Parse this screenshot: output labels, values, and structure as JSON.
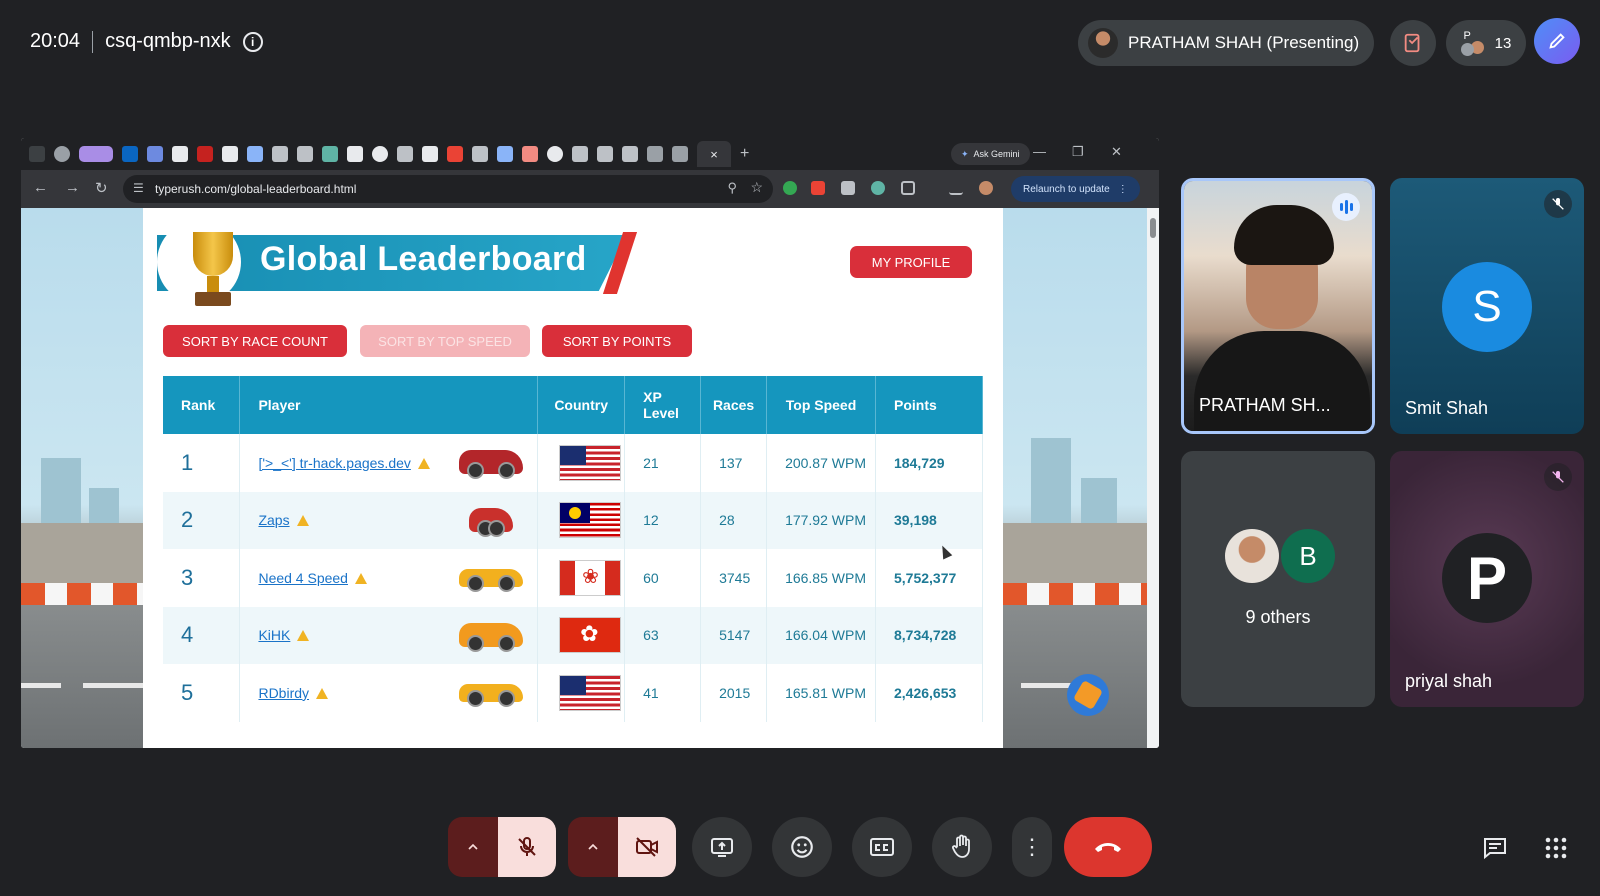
{
  "meeting": {
    "time": "20:04",
    "code": "csq-qmbp-nxk",
    "presenter_label": "PRATHAM SHAH (Presenting)",
    "participant_count": "13",
    "participant_initial": "P"
  },
  "browser": {
    "active_tab_close": "×",
    "new_tab": "+",
    "ask_gemini": "Ask Gemini",
    "url": "typerush.com/global-leaderboard.html",
    "relaunch": "Relaunch to update"
  },
  "page": {
    "title": "Global Leaderboard",
    "my_profile": "MY PROFILE",
    "sort_race_count": "SORT BY RACE COUNT",
    "sort_top_speed": "SORT BY TOP SPEED",
    "sort_points": "SORT BY POINTS",
    "columns": [
      "Rank",
      "Player",
      "Country",
      "XP Level",
      "Races",
      "Top Speed",
      "Points"
    ],
    "rows": [
      {
        "rank": "1",
        "player": "['>_<'] tr-hack.pages.dev",
        "country": "us",
        "xp": "21",
        "races": "137",
        "speed": "200.87 WPM",
        "points": "184,729",
        "vehicle_color": "#b3262a"
      },
      {
        "rank": "2",
        "player": "Zaps",
        "country": "my",
        "xp": "12",
        "races": "28",
        "speed": "177.92 WPM",
        "points": "39,198",
        "vehicle_color": "#c9302c"
      },
      {
        "rank": "3",
        "player": "Need 4 Speed",
        "country": "ca",
        "xp": "60",
        "races": "3745",
        "speed": "166.85 WPM",
        "points": "5,752,377",
        "vehicle_color": "#f2b01e"
      },
      {
        "rank": "4",
        "player": "KiHK",
        "country": "hk",
        "xp": "63",
        "races": "5147",
        "speed": "166.04 WPM",
        "points": "8,734,728",
        "vehicle_color": "#f29a1e"
      },
      {
        "rank": "5",
        "player": "RDbirdy",
        "country": "us",
        "xp": "41",
        "races": "2015",
        "speed": "165.81 WPM",
        "points": "2,426,653",
        "vehicle_color": "#f2b01e"
      }
    ]
  },
  "participants": {
    "pratham": "PRATHAM SH...",
    "smit": "Smit Shah",
    "smit_initial": "S",
    "others_label": "9 others",
    "others_initial": "B",
    "priyal": "priyal shah",
    "priyal_initial": "P"
  },
  "colors": {
    "accent_red": "#d92f3a",
    "table_header": "#1596be",
    "end_call": "#dc362e"
  }
}
